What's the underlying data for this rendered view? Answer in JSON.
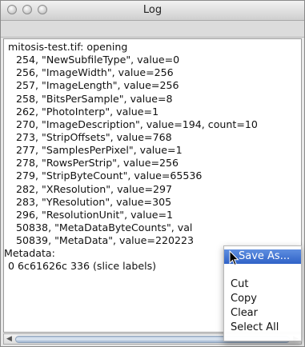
{
  "window": {
    "title": "Log"
  },
  "log": {
    "lines": [
      "mitosis-test.tif: opening",
      "254, \"NewSubfileType\", value=0",
      "256, \"ImageWidth\", value=256",
      "257, \"ImageLength\", value=256",
      "258, \"BitsPerSample\", value=8",
      "262, \"PhotoInterp\", value=1",
      "270, \"ImageDescription\", value=194, count=10",
      "273, \"StripOffsets\", value=768",
      "277, \"SamplesPerPixel\", value=1",
      "278, \"RowsPerStrip\", value=256",
      "279, \"StripByteCount\", value=65536",
      "282, \"XResolution\", value=297",
      "283, \"YResolution\", value=305",
      "296, \"ResolutionUnit\", value=1",
      "50838, \"MetaDataByteCounts\", val",
      "50839, \"MetaData\", value=220223",
      "Metadata:",
      "0 6c61626c 336 (slice labels)"
    ]
  },
  "context_menu": {
    "save_as": "Save As...",
    "cut": "Cut",
    "copy": "Copy",
    "clear": "Clear",
    "select_all": "Select All"
  },
  "icons": {
    "window_buttons": "traffic-light-icons",
    "scroll_left": "scroll-left-arrow-icon",
    "scroll_right": "scroll-right-arrow-icon",
    "cursor": "mouse-pointer-icon"
  },
  "colors": {
    "menu_highlight": "#3a6fd0"
  }
}
